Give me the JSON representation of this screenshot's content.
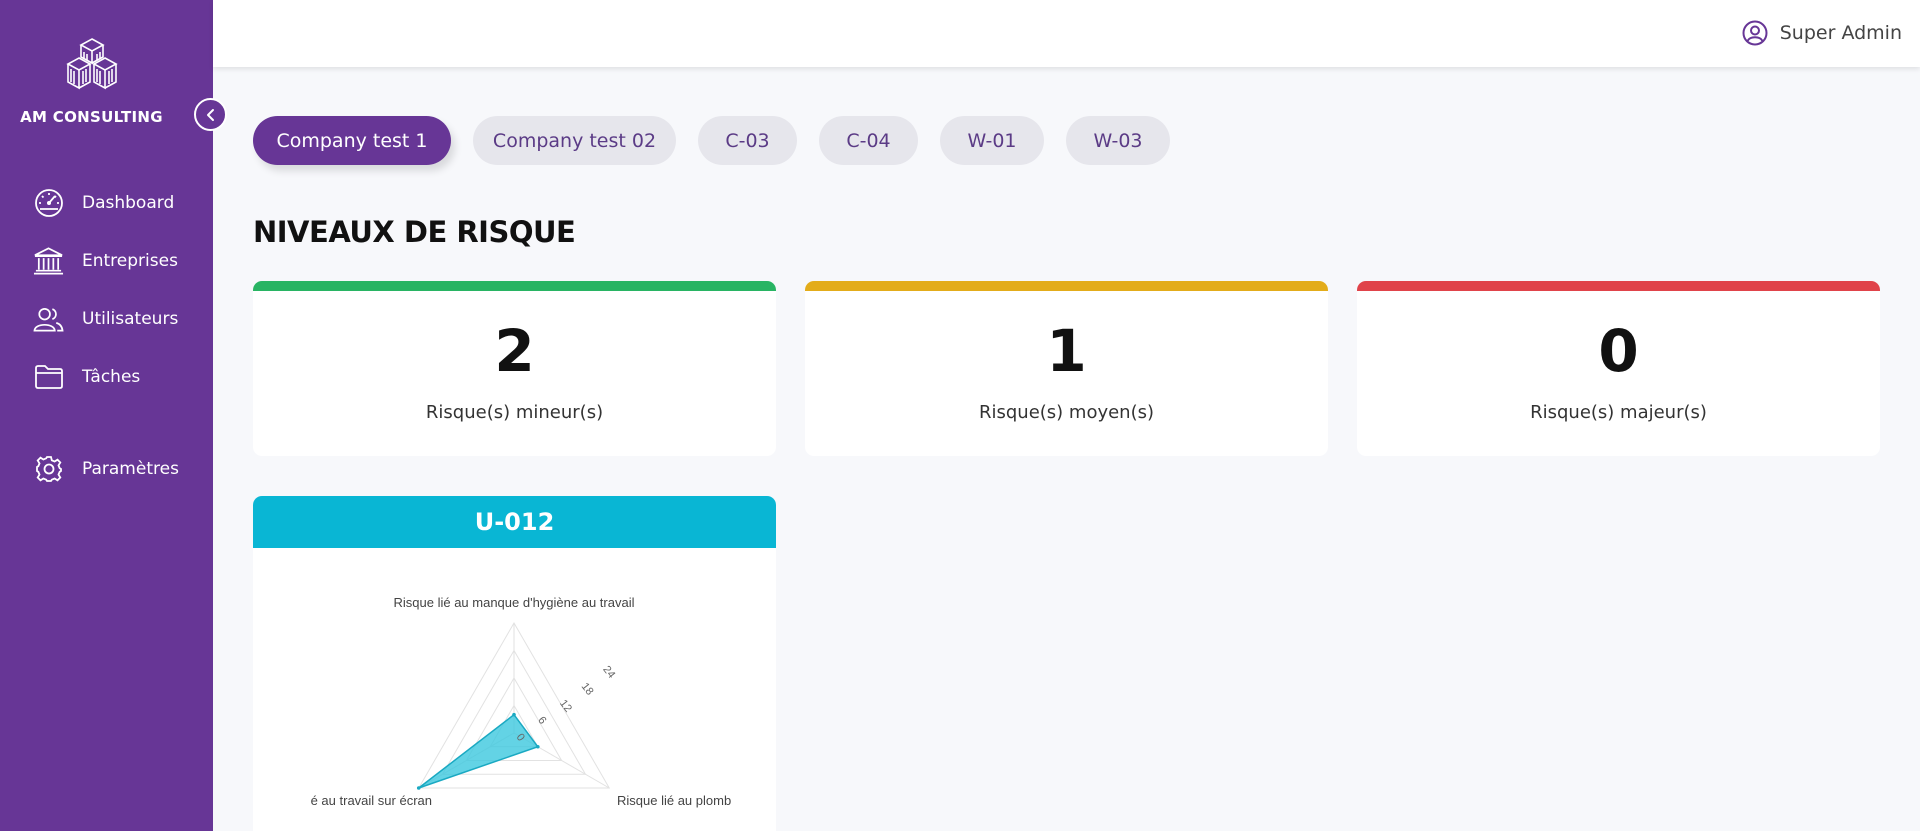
{
  "brand": {
    "name": "AM CONSULTING",
    "logo_icon": "cubes-building-logo"
  },
  "sidebar": {
    "items": [
      {
        "label": "Dashboard",
        "icon": "speedometer-icon"
      },
      {
        "label": "Entreprises",
        "icon": "bank-icon"
      },
      {
        "label": "Utilisateurs",
        "icon": "users-icon"
      },
      {
        "label": "Tâches",
        "icon": "folder-icon"
      },
      {
        "label": "Paramètres",
        "icon": "gear-icon"
      }
    ],
    "collapse_icon": "chevron-left-icon"
  },
  "header": {
    "user_label": "Super Admin",
    "user_icon": "user-circle-icon"
  },
  "companies": {
    "tabs": [
      "Company test 1",
      "Company test 02",
      "C-03",
      "C-04",
      "W-01",
      "W-03"
    ],
    "active_index": 0
  },
  "section_title": "NIVEAUX DE RISQUE",
  "risk_cards": [
    {
      "value": "2",
      "label": "Risque(s) mineur(s)",
      "color": "#28b463"
    },
    {
      "value": "1",
      "label": "Risque(s) moyen(s)",
      "color": "#e3ac1a"
    },
    {
      "value": "0",
      "label": "Risque(s) majeur(s)",
      "color": "#e0434a"
    }
  ],
  "colors": {
    "sidebar": "#673696",
    "accent": "#673696",
    "chart_header": "#09b6d4",
    "chart_fill": "#3cc8df"
  },
  "chart_card": {
    "title": "U-012",
    "chart_data": {
      "type": "radar",
      "axes": [
        "Risque lié au manque d'hygiène au travail",
        "Risque lié au plomb",
        "Risque lié au travail sur écran"
      ],
      "axes_visible_text": [
        "Risque lié au manque d'hygiène au travail",
        "Risque lié au plomb",
        "é au travail sur écran"
      ],
      "values": [
        4,
        6,
        24
      ],
      "r_ticks": [
        "0",
        "6",
        "12",
        "18",
        "24"
      ],
      "r_max": 24,
      "grid": true
    }
  }
}
